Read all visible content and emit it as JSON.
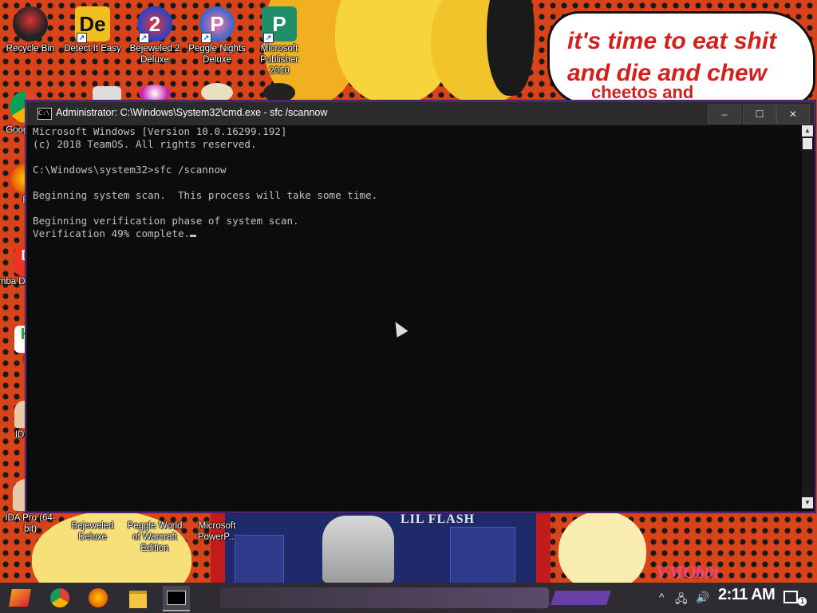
{
  "desktop": {
    "wallpaper_text": [
      "it's time to eat shit",
      "and die and chew",
      "cheetos and"
    ],
    "poster_title": "LIL FLASH",
    "watermark": "VMOb0t",
    "icons": [
      {
        "label": "Recycle Bin",
        "icon": "recycle-bin-icon"
      },
      {
        "label": "Detect It Easy",
        "icon": "detect-it-easy-icon"
      },
      {
        "label": "Bejeweled 2 Deluxe",
        "icon": "bejeweled-icon"
      },
      {
        "label": "Peggle Nights Deluxe",
        "icon": "peggle-icon"
      },
      {
        "label": "Microsoft Publisher 2010",
        "icon": "publisher-icon"
      },
      {
        "label": "Googl",
        "icon": "chrome-icon"
      },
      {
        "label": "Fi",
        "icon": "firefox-icon"
      },
      {
        "label": "Emba De",
        "icon": "embarcadero-icon"
      },
      {
        "label": "H",
        "icon": "hex-icon"
      },
      {
        "label": "IDA",
        "icon": "ida-icon"
      },
      {
        "label": "IDA Pro (64-bit)",
        "icon": "ida-icon"
      },
      {
        "label": "Bejeweled Deluxe",
        "icon": "bejeweled-icon"
      },
      {
        "label": "Peggle World of Warcraft Edition",
        "icon": "peggle-icon"
      },
      {
        "label": "Microsoft PowerP...",
        "icon": "powerpoint-icon"
      }
    ]
  },
  "cmd": {
    "title": "Administrator: C:\\Windows\\System32\\cmd.exe - sfc  /scannow",
    "controls": {
      "minimize": "–",
      "maximize": "☐",
      "close": "✕"
    },
    "lines": [
      "Microsoft Windows [Version 10.0.16299.192]",
      "(c) 2018 TeamOS. All rights reserved.",
      "",
      "C:\\Windows\\system32>sfc /scannow",
      "",
      "Beginning system scan.  This process will take some time.",
      "",
      "Beginning verification phase of system scan.",
      "Verification 49% complete."
    ],
    "colors": {
      "background": "#0c0c0c",
      "text": "#c0c0c0"
    }
  },
  "taskbar": {
    "clock": "2:11 AM",
    "notification_count": "1",
    "pinned": [
      "start-icon",
      "chrome-icon",
      "firefox-icon",
      "file-explorer-icon",
      "cmd-icon"
    ]
  }
}
